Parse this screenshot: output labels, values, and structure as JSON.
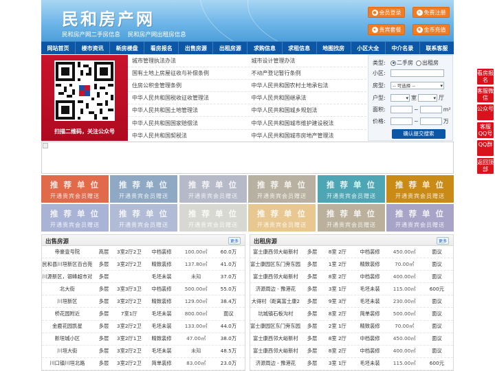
{
  "header": {
    "title": "民和房产网",
    "subtitles": [
      "民和房产网二手房信息",
      "民和房产网出租房信息"
    ],
    "buttons": [
      {
        "label": "会员登录",
        "icon": "user-icon"
      },
      {
        "label": "免费注册",
        "icon": "register-icon"
      },
      {
        "label": "贵宾套餐",
        "icon": "vip-icon"
      },
      {
        "label": "金币充值",
        "icon": "coin-icon"
      }
    ]
  },
  "nav": [
    "网站首页",
    "楼市资讯",
    "新房楼盘",
    "看房报名",
    "出售房源",
    "出租房源",
    "求购信息",
    "求租信息",
    "地图找房",
    "小区大全",
    "中介名录",
    "联系客服"
  ],
  "qr": {
    "caption": "扫描二维码，关注公众号"
  },
  "links": [
    [
      "城市管理执法办法",
      "城市设计管理办法"
    ],
    [
      "国有土地上房屋征收与补偿条例",
      "不动产登记暂行条例"
    ],
    [
      "住房公积金管理条例",
      "中华人民共和国农村土地承包法"
    ],
    [
      "中华人民共和国税收征收管理法",
      "中华人民共和国继承法"
    ],
    [
      "中华人民共和国土地管理法",
      "中华人民共和国城乡规划法"
    ],
    [
      "中华人民共和国国家赔偿法",
      "中华人民共和国城市维护建设税法"
    ],
    [
      "中华人民共和国契税法",
      "中华人民共和国城市房地产管理法"
    ]
  ],
  "search": {
    "type_label": "类型:",
    "type_options": [
      "二手房",
      "出租房"
    ],
    "type_selected": "二手房",
    "community_label": "小区:",
    "community_value": "",
    "house_type_label": "房型:",
    "house_type_value": "-- 可选择 --",
    "layout_label": "户型:",
    "layout_unit1": "室",
    "layout_unit2": "厅",
    "area_label": "面积:",
    "area_sep": "~",
    "area_unit": "m²",
    "price_label": "价格:",
    "price_sep": "~",
    "price_unit": "万",
    "submit": "确认提交搜索"
  },
  "ads": {
    "line1": "推 荐 单 位",
    "line2": "开通贵宾会员赠送",
    "colors": [
      "#e06a4a",
      "#8fa9c4",
      "#b6b9c8",
      "#b8b0a0",
      "#4ea6b4",
      "#c98a16",
      "#a9b3d6",
      "#b1bbd6",
      "#d8d8d2",
      "#e8c890",
      "#bab09c",
      "#a8a4c8"
    ]
  },
  "sale": {
    "title": "出售房源",
    "more": "更多",
    "rows": [
      [
        "帝豪壹号院",
        "高层",
        "3室2厅2卫",
        "中档装修",
        "100.00㎡",
        "60.0万"
      ],
      [
        "民和县川垣新区百合苑",
        "多层",
        "3室2厅2卫",
        "精致装修",
        "137.80㎡",
        "41.0万"
      ],
      [
        "川源新区，银峰超市对",
        "多层",
        "",
        "毛坯未装",
        "未知",
        "37.0万"
      ],
      [
        "北大街",
        "多层",
        "3室3厅3卫",
        "中档装修",
        "500.00㎡",
        "55.0万"
      ],
      [
        "川垣新区",
        "多层",
        "3室2厅2卫",
        "精致装修",
        "129.00㎡",
        "38.4万"
      ],
      [
        "桥花园附近",
        "多层",
        "7室1厅",
        "毛坯未装",
        "800.00㎡",
        "面议"
      ],
      [
        "金鹿花园凯星",
        "多层",
        "3室2厅2卫",
        "毛坯未装",
        "133.00㎡",
        "44.0万"
      ],
      [
        "新垣城小区",
        "多层",
        "3室2厅1卫",
        "精致装修",
        "47.00㎡",
        "38.0万"
      ],
      [
        "川垣大街",
        "多层",
        "3室2厅2卫",
        "毛坯未装",
        "未知",
        "48.5万"
      ],
      [
        "川口镇川垣北路",
        "多层",
        "3室2厅2卫",
        "简单装修",
        "83.00㎡",
        "23.0万"
      ]
    ]
  },
  "rent": {
    "title": "出租房源",
    "more": "更多",
    "rows": [
      [
        "富士康西邻大峪新村",
        "多层",
        "8室 2厅",
        "中档装修",
        "450.00㎡",
        "面议"
      ],
      [
        "富士康园区东门旁东园三号",
        "多层",
        "1室 2厅",
        "精致装修",
        "70.00㎡",
        "面议"
      ],
      [
        "富士康西邻大峪新村",
        "多层",
        "8室 2厅",
        "中档装修",
        "400.00㎡",
        "面议"
      ],
      [
        "济源周边 - 豫港花",
        "多层",
        "3室 1厅",
        "毛坯未装",
        "115.00㎡",
        "600元"
      ],
      [
        "大得村（距离富士康2",
        "多层",
        "9室 3厅",
        "毛坯未装",
        "230.00㎡",
        "面议"
      ],
      [
        "坑城镇石板沟村",
        "多层",
        "8室 2厅",
        "简单装修",
        "500.00㎡",
        "面议"
      ],
      [
        "富士康园区东门旁东园三号",
        "多层",
        "2室 1厅",
        "精致装修",
        "70.00㎡",
        "面议"
      ],
      [
        "富士康西邻大峪新村",
        "多层",
        "8室 2厅",
        "中档装修",
        "450.00㎡",
        "面议"
      ],
      [
        "富士康西邻大峪新村",
        "多层",
        "8室 2厅",
        "中档装修",
        "400.00㎡",
        "面议"
      ],
      [
        "济源周边 - 豫港花",
        "多层",
        "3室 1厅",
        "毛坯未装",
        "115.00㎡",
        "600元"
      ]
    ]
  },
  "float_bar": [
    "看房报名",
    "客服微信",
    "公众号",
    "客服QQ号",
    "QQ群",
    "返回顶部"
  ]
}
